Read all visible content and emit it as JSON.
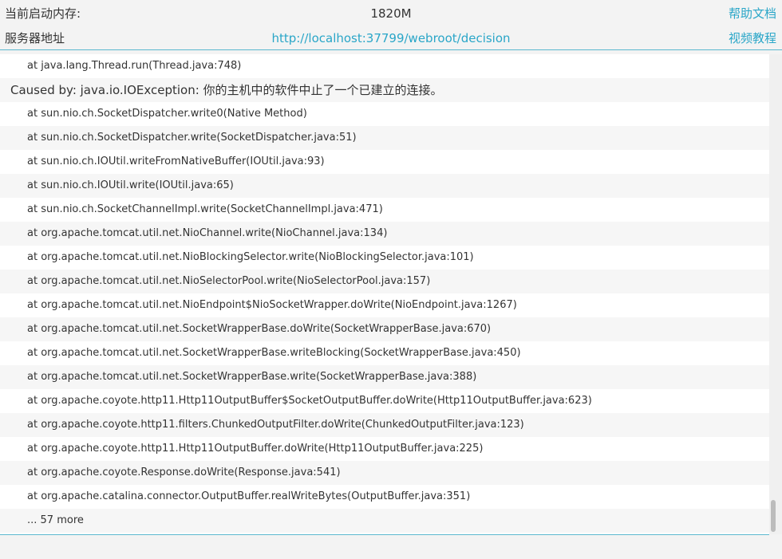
{
  "header": {
    "memory_label": "当前启动内存:",
    "memory_value": "1820M",
    "help_link": "帮助文档",
    "server_label": "服务器地址",
    "server_url": "http://localhost:37799/webroot/decision",
    "video_link": "视频教程"
  },
  "log": {
    "lines": [
      "at java.lang.Thread.run(Thread.java:748)",
      "Caused by: java.io.IOException: 你的主机中的软件中止了一个已建立的连接。",
      "at sun.nio.ch.SocketDispatcher.write0(Native Method)",
      "at sun.nio.ch.SocketDispatcher.write(SocketDispatcher.java:51)",
      "at sun.nio.ch.IOUtil.writeFromNativeBuffer(IOUtil.java:93)",
      "at sun.nio.ch.IOUtil.write(IOUtil.java:65)",
      "at sun.nio.ch.SocketChannelImpl.write(SocketChannelImpl.java:471)",
      "at org.apache.tomcat.util.net.NioChannel.write(NioChannel.java:134)",
      "at org.apache.tomcat.util.net.NioBlockingSelector.write(NioBlockingSelector.java:101)",
      "at org.apache.tomcat.util.net.NioSelectorPool.write(NioSelectorPool.java:157)",
      "at org.apache.tomcat.util.net.NioEndpoint$NioSocketWrapper.doWrite(NioEndpoint.java:1267)",
      "at org.apache.tomcat.util.net.SocketWrapperBase.doWrite(SocketWrapperBase.java:670)",
      "at org.apache.tomcat.util.net.SocketWrapperBase.writeBlocking(SocketWrapperBase.java:450)",
      "at org.apache.tomcat.util.net.SocketWrapperBase.write(SocketWrapperBase.java:388)",
      "at org.apache.coyote.http11.Http11OutputBuffer$SocketOutputBuffer.doWrite(Http11OutputBuffer.java:623)",
      "at org.apache.coyote.http11.filters.ChunkedOutputFilter.doWrite(ChunkedOutputFilter.java:123)",
      "at org.apache.coyote.http11.Http11OutputBuffer.doWrite(Http11OutputBuffer.java:225)",
      "at org.apache.coyote.Response.doWrite(Response.java:541)",
      "at org.apache.catalina.connector.OutputBuffer.realWriteBytes(OutputBuffer.java:351)",
      "... 57 more"
    ]
  }
}
